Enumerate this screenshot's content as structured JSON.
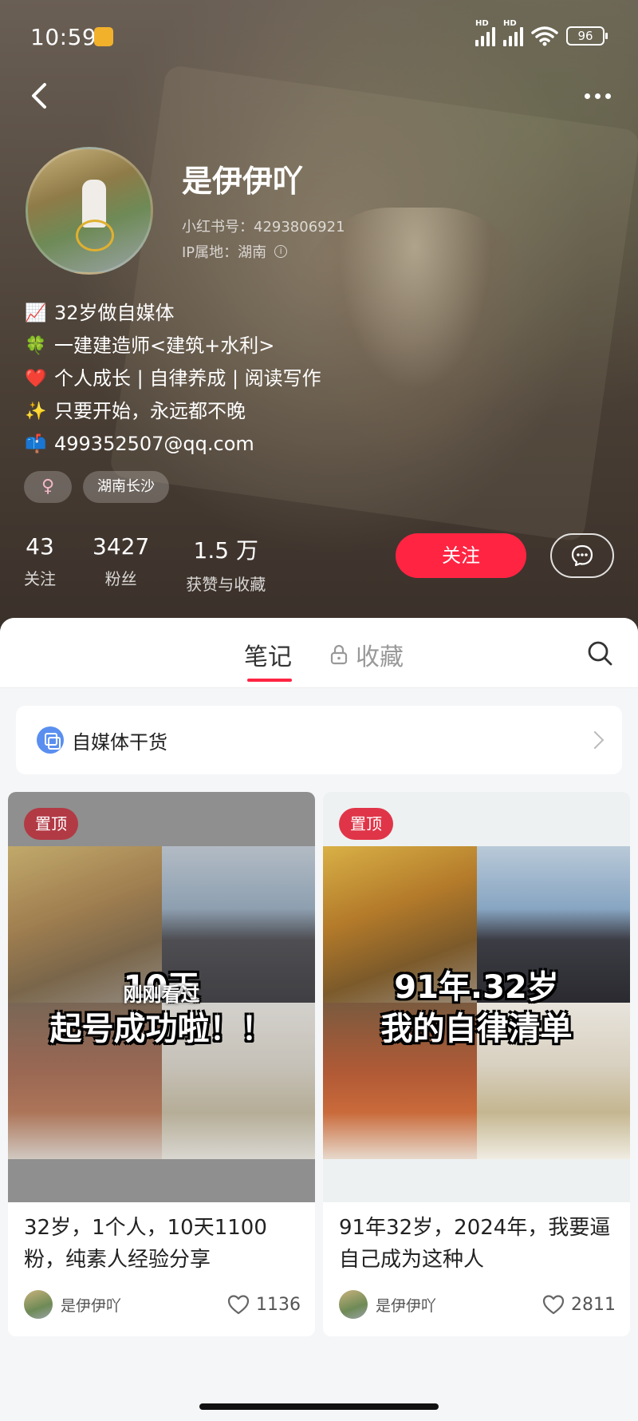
{
  "status_bar": {
    "time": "10:59",
    "battery": "96"
  },
  "profile": {
    "nickname": "是伊伊吖",
    "id_text": "小红书号：4293806921",
    "ip_text": "IP属地：湖南",
    "bio": [
      {
        "icon": "chart-up-icon",
        "emoji": "📈",
        "text": "32岁做自媒体"
      },
      {
        "icon": "clover-icon",
        "emoji": "🍀",
        "text": "一建建造师<建筑+水利>"
      },
      {
        "icon": "heart-icon",
        "emoji": "❤️",
        "text": "个人成长 | 自律养成 | 阅读写作"
      },
      {
        "icon": "sparkles-icon",
        "emoji": "✨",
        "text": "只要开始，永远都不晚"
      },
      {
        "icon": "mailbox-icon",
        "emoji": "📫",
        "text": "499352507@qq.com"
      }
    ],
    "tags": {
      "gender": "♀",
      "location": "湖南长沙"
    },
    "stats": [
      {
        "num": "43",
        "label": "关注"
      },
      {
        "num": "3427",
        "label": "粉丝"
      },
      {
        "num": "1.5 万",
        "label": "获赞与收藏"
      }
    ],
    "follow_label": "关注"
  },
  "tabs": {
    "notes": "笔记",
    "collect": "收藏"
  },
  "collection": {
    "label": "自媒体干货"
  },
  "notes": [
    {
      "pin": "置顶",
      "overlay_line1": "10天",
      "overlay_line2": "起号成功啦！！",
      "viewed": "刚刚看过",
      "title": "32岁，1个人，10天1100粉，纯素人经验分享",
      "author": "是伊伊吖",
      "likes": "1136"
    },
    {
      "pin": "置顶",
      "overlay_line1": "91年.32岁",
      "overlay_line2": "我的自律清单",
      "title": "91年32岁，2024年，我要逼自己成为这种人",
      "author": "是伊伊吖",
      "likes": "2811"
    }
  ],
  "colors": {
    "accent": "#ff2442",
    "pin_badge": "#e03548"
  }
}
